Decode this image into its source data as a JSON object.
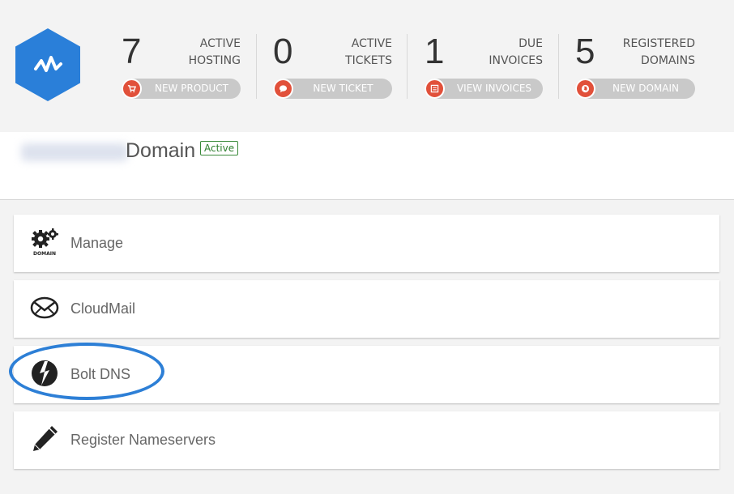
{
  "header": {
    "stats": [
      {
        "number": "7",
        "label_line1": "ACTIVE",
        "label_line2": "HOSTING",
        "button": "NEW PRODUCT",
        "button_icon": "cart-icon"
      },
      {
        "number": "0",
        "label_line1": "ACTIVE",
        "label_line2": "TICKETS",
        "button": "NEW TICKET",
        "button_icon": "chat-bubble-icon"
      },
      {
        "number": "1",
        "label_line1": "DUE",
        "label_line2": "INVOICES",
        "button": "VIEW INVOICES",
        "button_icon": "list-icon"
      },
      {
        "number": "5",
        "label_line1": "REGISTERED",
        "label_line2": "DOMAINS",
        "button": "NEW DOMAIN",
        "button_icon": "globe-icon"
      }
    ],
    "accent_color": "#e1503a",
    "logo_color": "#2a7fd9"
  },
  "domain": {
    "title": "Domain",
    "status": "Active"
  },
  "menu": [
    {
      "label": "Manage",
      "icon": "gear-domain-icon",
      "icon_caption": "DOMAIN"
    },
    {
      "label": "CloudMail",
      "icon": "envelope-icon"
    },
    {
      "label": "Bolt DNS",
      "icon": "bolt-dns-icon"
    },
    {
      "label": "Register Nameservers",
      "icon": "pencil-icon"
    }
  ]
}
